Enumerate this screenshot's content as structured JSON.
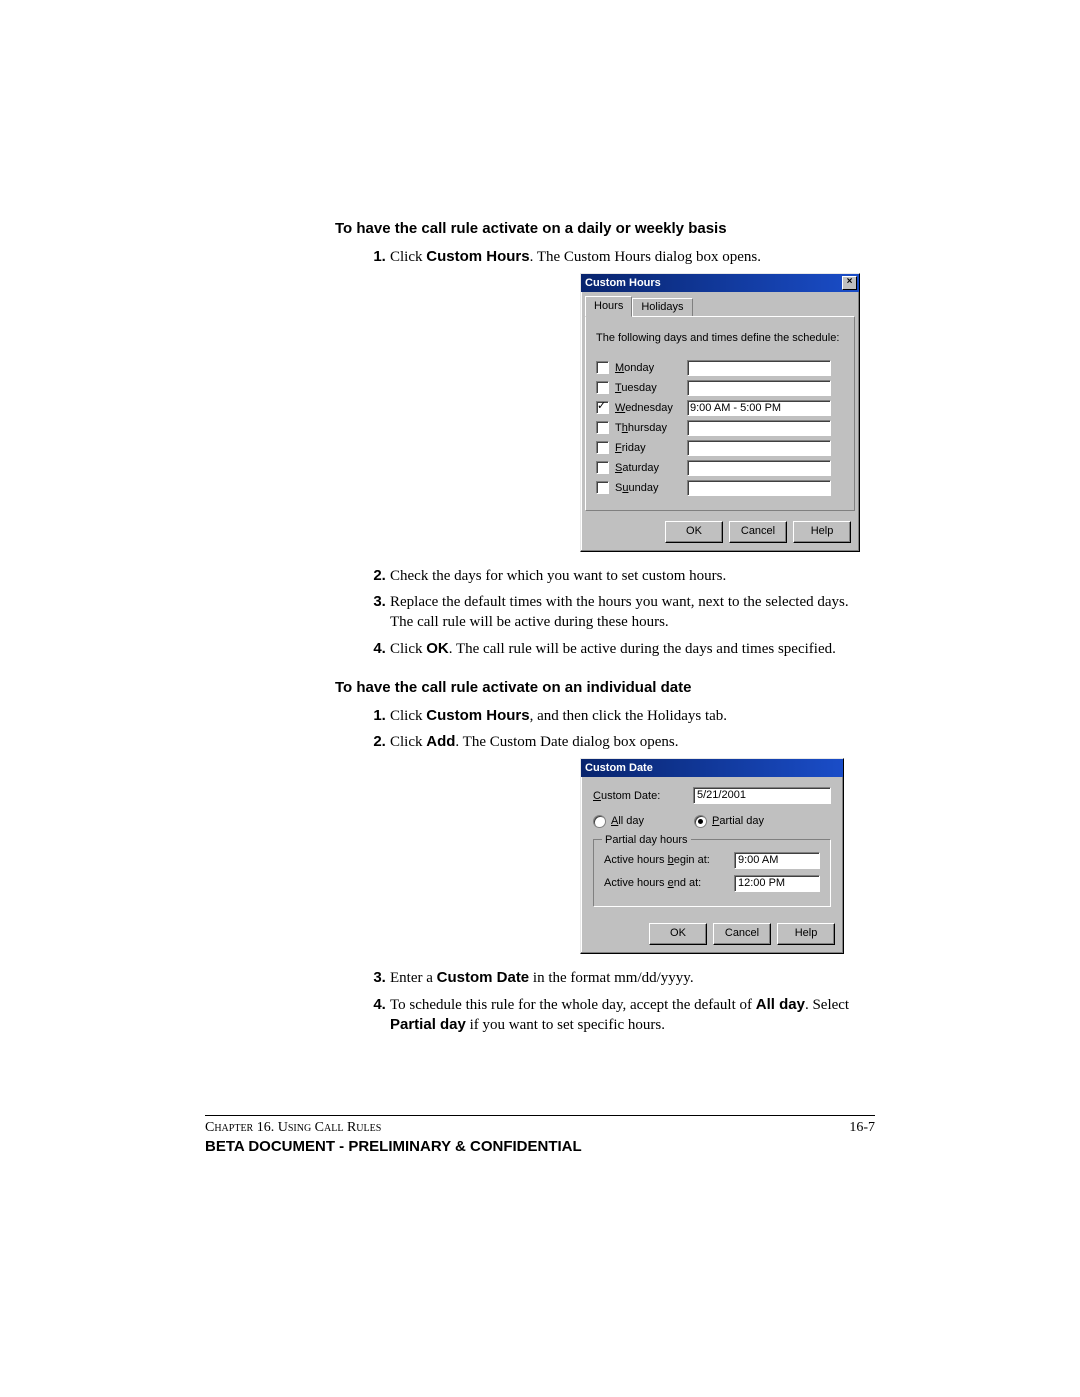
{
  "section1": {
    "heading": "To have the call rule activate on a daily or weekly basis",
    "step1_prefix": "Click ",
    "step1_bold": "Custom Hours",
    "step1_suffix": ". The Custom Hours dialog box opens.",
    "step2": "Check the days for which you want to set custom hours.",
    "step3": "Replace the default times with the hours you want, next to the selected days. The call rule will be active during these hours.",
    "step4_prefix": "Click ",
    "step4_bold": "OK",
    "step4_suffix": ". The call rule will be active during the days and times specified."
  },
  "dialog1": {
    "title": "Custom Hours",
    "tab_hours": "Hours",
    "tab_holidays": "Holidays",
    "instruction": "The following days and times define the schedule:",
    "days": {
      "mon": "onday",
      "tue": "uesday",
      "wed": "ednesday",
      "thu": "hursday",
      "fri": "riday",
      "sat": "aturday",
      "sun": "unday"
    },
    "checked_day": "wed",
    "wed_time": "9:00 AM - 5:00 PM",
    "ok": "OK",
    "cancel": "Cancel",
    "help": "Help"
  },
  "section2": {
    "heading": "To have the call rule activate on an individual date",
    "step1_prefix": "Click ",
    "step1_bold": "Custom Hours",
    "step1_suffix": ", and then click the Holidays tab.",
    "step2_prefix": "Click ",
    "step2_bold": "Add",
    "step2_suffix": ". The Custom Date dialog box opens.",
    "step3_prefix": "Enter a ",
    "step3_bold": "Custom Date",
    "step3_suffix": " in the format mm/dd/yyyy.",
    "step4_a": "To schedule this rule for the whole day, accept the default of ",
    "step4_b": "All day",
    "step4_c": ". Select ",
    "step4_d": "Partial day",
    "step4_e": " if you want to set specific hours."
  },
  "dialog2": {
    "title": "Custom Date",
    "date_label_rest": "ustom Date:",
    "date_value": "5/21/2001",
    "radio_all_rest": "ll day",
    "radio_partial_rest": "artial day",
    "group_title": "Partial day hours",
    "begin_label_a": "Active hours ",
    "begin_label_rest": "egin at:",
    "begin_value": "9:00 AM",
    "end_label_a": "Active hours ",
    "end_label_rest": "nd at:",
    "end_value": "12:00 PM",
    "ok": "OK",
    "cancel": "Cancel",
    "help": "Help"
  },
  "footer": {
    "chapter": "Chapter 16. Using Call Rules",
    "page": "16-7",
    "confidential": "BETA DOCUMENT - PRELIMINARY & CONFIDENTIAL"
  }
}
